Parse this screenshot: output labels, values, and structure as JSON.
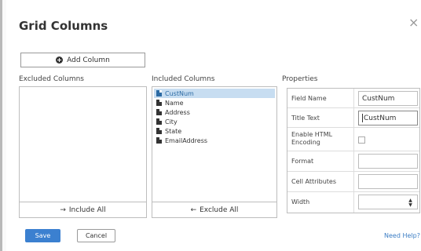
{
  "dialog": {
    "title": "Grid Columns",
    "close_icon": "close-icon",
    "close_glyph": "×"
  },
  "toolbar": {
    "add_column_label": "Add Column",
    "add_icon": "plus-circle-icon"
  },
  "excluded": {
    "label": "Excluded Columns",
    "items": [],
    "include_all_label": "Include All",
    "include_all_arrow": "→"
  },
  "included": {
    "label": "Included Columns",
    "items": [
      {
        "label": "CustNum",
        "selected": true
      },
      {
        "label": "Name",
        "selected": false
      },
      {
        "label": "Address",
        "selected": false
      },
      {
        "label": "City",
        "selected": false
      },
      {
        "label": "State",
        "selected": false
      },
      {
        "label": "EmailAddress",
        "selected": false
      }
    ],
    "exclude_all_label": "Exclude All",
    "exclude_all_arrow": "←"
  },
  "properties": {
    "label": "Properties",
    "field_name_label": "Field Name",
    "field_name_value": "CustNum",
    "title_text_label": "Title Text",
    "title_text_value": "CustNum",
    "enable_html_label_1": "Enable HTML",
    "enable_html_label_2": "Encoding",
    "enable_html_checked": false,
    "format_label": "Format",
    "format_value": "",
    "cell_attributes_label": "Cell Attributes",
    "cell_attributes_value": "",
    "width_label": "Width",
    "width_value": ""
  },
  "footer": {
    "save_label": "Save",
    "cancel_label": "Cancel",
    "help_label": "Need Help?"
  },
  "colors": {
    "accent": "#3b80d0",
    "selection": "#c7ddf1",
    "link": "#3b7dc4"
  }
}
